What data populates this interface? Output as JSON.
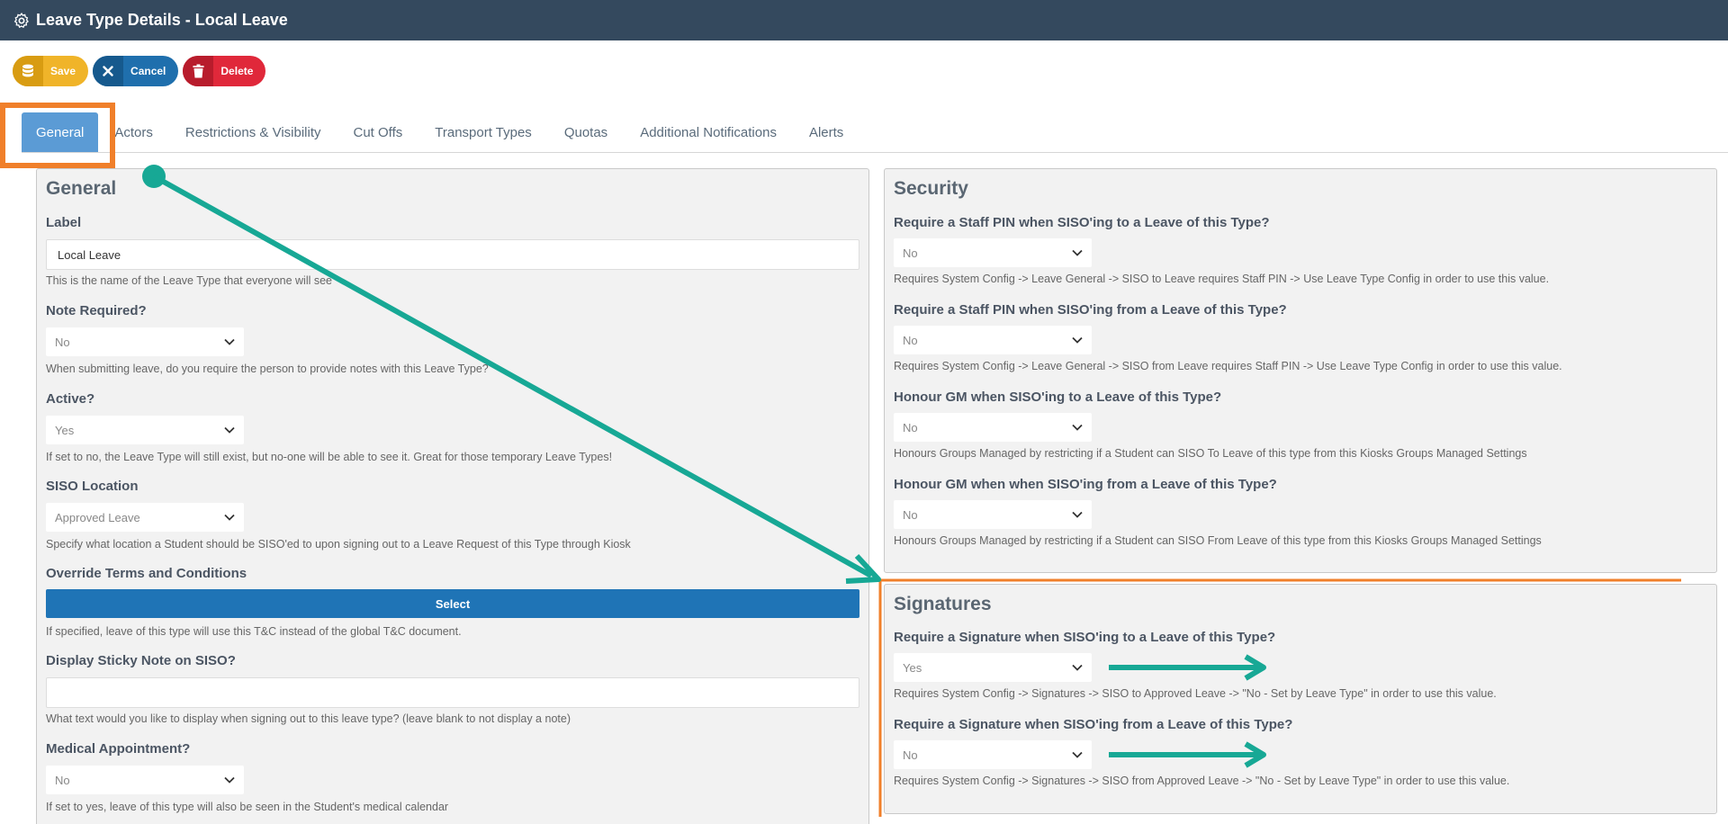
{
  "header": {
    "title": "Leave Type Details - Local Leave",
    "gear_icon": "gear-icon"
  },
  "toolbar": {
    "save_label": "Save",
    "cancel_label": "Cancel",
    "delete_label": "Delete"
  },
  "tabs": [
    {
      "label": "General",
      "active": true
    },
    {
      "label": "Actors"
    },
    {
      "label": "Restrictions & Visibility"
    },
    {
      "label": "Cut Offs"
    },
    {
      "label": "Transport Types"
    },
    {
      "label": "Quotas"
    },
    {
      "label": "Additional Notifications"
    },
    {
      "label": "Alerts"
    }
  ],
  "general": {
    "title": "General",
    "label_field": {
      "label": "Label",
      "value": "Local Leave",
      "help": "This is the name of the Leave Type that everyone will see"
    },
    "note_required": {
      "label": "Note Required?",
      "value": "No",
      "help": "When submitting leave, do you require the person to provide notes with this Leave Type?"
    },
    "active": {
      "label": "Active?",
      "value": "Yes",
      "help": "If set to no, the Leave Type will still exist, but no-one will be able to see it. Great for those temporary Leave Types!"
    },
    "siso_location": {
      "label": "SISO Location",
      "value": "Approved Leave",
      "help": "Specify what location a Student should be SISO'ed to upon signing out to a Leave Request of this Type through Kiosk"
    },
    "override_terms": {
      "label": "Override Terms and Conditions",
      "button": "Select",
      "help": "If specified, leave of this type will use this T&C instead of the global T&C document."
    },
    "sticky_note": {
      "label": "Display Sticky Note on SISO?",
      "value": "",
      "help": "What text would you like to display when signing out to this leave type? (leave blank to not display a note)"
    },
    "medical": {
      "label": "Medical Appointment?",
      "value": "No",
      "help": "If set to yes, leave of this type will also be seen in the Student's medical calendar"
    }
  },
  "security": {
    "title": "Security",
    "pin_to": {
      "label": "Require a Staff PIN when SISO'ing to a Leave of this Type?",
      "value": "No",
      "help": "Requires System Config -> Leave General -> SISO to Leave requires Staff PIN -> Use Leave Type Config in order to use this value."
    },
    "pin_from": {
      "label": "Require a Staff PIN when SISO'ing from a Leave of this Type?",
      "value": "No",
      "help": "Requires System Config -> Leave General -> SISO from Leave requires Staff PIN -> Use Leave Type Config in order to use this value."
    },
    "gm_to": {
      "label": "Honour GM when SISO'ing to a Leave of this Type?",
      "value": "No",
      "help": "Honours Groups Managed by restricting if a Student can SISO To Leave of this type from this Kiosks Groups Managed Settings"
    },
    "gm_from": {
      "label": "Honour GM when when SISO'ing from a Leave of this Type?",
      "value": "No",
      "help": "Honours Groups Managed by restricting if a Student can SISO From Leave of this type from this Kiosks Groups Managed Settings"
    }
  },
  "signatures": {
    "title": "Signatures",
    "sig_to": {
      "label": "Require a Signature when SISO'ing to a Leave of this Type?",
      "value": "Yes",
      "help": "Requires System Config -> Signatures -> SISO to Approved Leave -> \"No - Set by Leave Type\" in order to use this value."
    },
    "sig_from": {
      "label": "Require a Signature when SISO'ing from a Leave of this Type?",
      "value": "No",
      "help": "Requires System Config -> Signatures -> SISO from Approved Leave -> \"No - Set by Leave Type\" in order to use this value."
    }
  },
  "colors": {
    "header_bg": "#34495e",
    "highlight": "#f07f2a",
    "annotation": "#17a895",
    "active_tab": "#5b9bd5"
  }
}
